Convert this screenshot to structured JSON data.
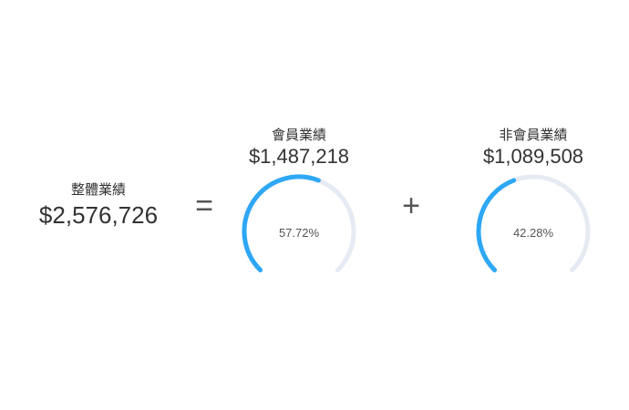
{
  "total": {
    "label": "整體業績",
    "amount": "$2,576,726"
  },
  "operators": {
    "equals": "=",
    "plus": "+"
  },
  "member": {
    "label": "會員業績",
    "amount": "$1,487,218",
    "percent_text": "57.72%",
    "percent": 57.72
  },
  "nonmember": {
    "label": "非會員業績",
    "amount": "$1,089,508",
    "percent_text": "42.28%",
    "percent": 42.28
  },
  "colors": {
    "gauge_fill": "#2ea7f5",
    "gauge_track": "#e6eaf3",
    "text": "#333333"
  }
}
